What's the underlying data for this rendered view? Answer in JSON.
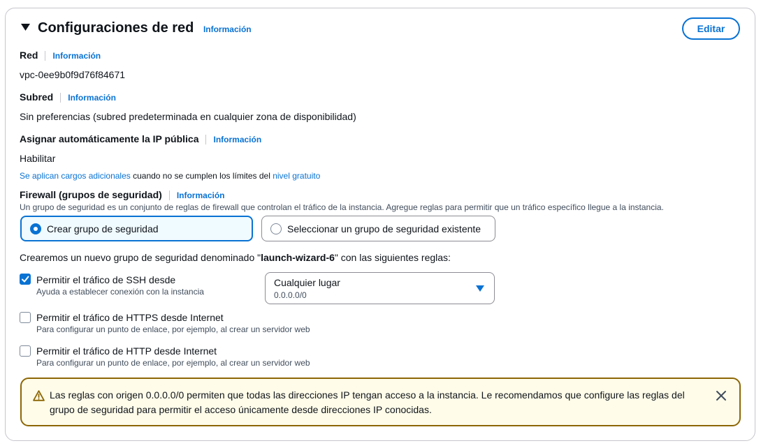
{
  "section": {
    "title": "Configuraciones de red",
    "info_label": "Información",
    "edit_label": "Editar"
  },
  "network": {
    "label": "Red",
    "info_label": "Información",
    "value": "vpc-0ee9b0f9d76f84671"
  },
  "subnet": {
    "label": "Subred",
    "info_label": "Información",
    "value": "Sin preferencias (subred predeterminada en cualquier zona de disponibilidad)"
  },
  "public_ip": {
    "label": "Asignar automáticamente la IP pública",
    "info_label": "Información",
    "value": "Habilitar",
    "note_link": "Se aplican cargos adicionales",
    "note_text": " cuando no se cumplen los límites del ",
    "note_link2": "nivel gratuito"
  },
  "firewall": {
    "label": "Firewall (grupos de seguridad)",
    "info_label": "Información",
    "description": "Un grupo de seguridad es un conjunto de reglas de firewall que controlan el tráfico de la instancia. Agregue reglas para permitir que un tráfico específico llegue a la instancia.",
    "option_create": "Crear grupo de seguridad",
    "option_select": "Seleccionar un grupo de seguridad existente",
    "selected_option": "Crear grupo de seguridad",
    "intro_before": "Crearemos un nuevo grupo de seguridad denominado \"",
    "group_name": "launch-wizard-6",
    "intro_after": "\" con las siguientes reglas:"
  },
  "rules": [
    {
      "label": "Permitir el tráfico de SSH desde",
      "description": "Ayuda a establecer conexión con la instancia",
      "checked": true
    },
    {
      "label": "Permitir el tráfico de HTTPS desde Internet",
      "description": "Para configurar un punto de enlace, por ejemplo, al crear un servidor web",
      "checked": false
    },
    {
      "label": "Permitir el tráfico de HTTP desde Internet",
      "description": "Para configurar un punto de enlace, por ejemplo, al crear un servidor web",
      "checked": false
    }
  ],
  "ssh_source": {
    "selected": "Cualquier lugar",
    "sub": "0.0.0.0/0"
  },
  "warning": {
    "text": "Las reglas con origen 0.0.0.0/0 permiten que todas las direcciones IP tengan acceso a la instancia. Le recomendamos que configure las reglas del grupo de seguridad para permitir el acceso únicamente desde direcciones IP conocidas."
  },
  "icons": {
    "expand": "caret-down-icon",
    "radio_selected": "radio-selected-icon",
    "checkbox_checked": "checkmark-icon",
    "dropdown": "caret-down-filled-icon",
    "warning": "warning-triangle-icon",
    "close": "close-icon"
  },
  "colors": {
    "link": "#0972d3",
    "warning_border": "#8d6605",
    "warning_background": "#fffce9",
    "selected_tile_background": "#f0fbff"
  }
}
